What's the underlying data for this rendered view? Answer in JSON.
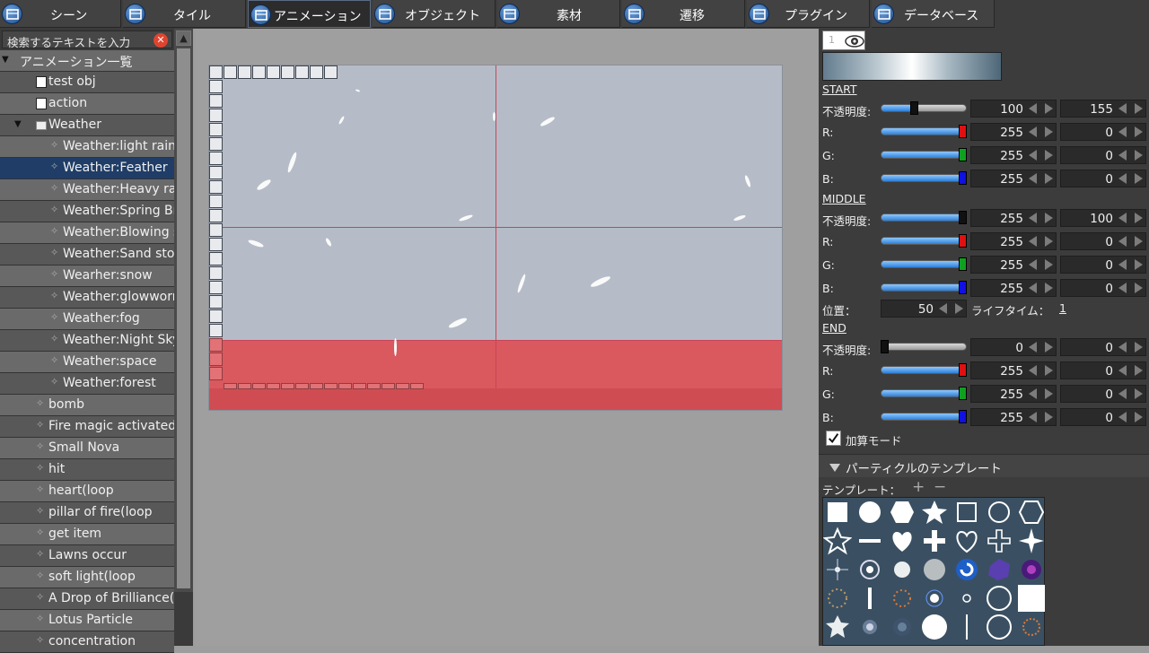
{
  "menu": {
    "tabs": [
      {
        "label": "シーン",
        "icon": "scene-icon"
      },
      {
        "label": "タイル",
        "icon": "tile-icon"
      },
      {
        "label": "アニメーション",
        "icon": "animation-icon",
        "active": true
      },
      {
        "label": "オブジェクト",
        "icon": "object-icon"
      },
      {
        "label": "素材",
        "icon": "material-icon"
      },
      {
        "label": "遷移",
        "icon": "transition-icon"
      },
      {
        "label": "プラグイン",
        "icon": "plugin-icon"
      },
      {
        "label": "データベース",
        "icon": "database-icon"
      }
    ]
  },
  "sidebar": {
    "search_placeholder": "検索するテキストを入力",
    "tree": [
      {
        "label": "アニメーション一覧",
        "kind": "root"
      },
      {
        "label": "test obj",
        "kind": "object"
      },
      {
        "label": "action",
        "kind": "object"
      },
      {
        "label": "Weather",
        "kind": "folder"
      },
      {
        "label": "Weather:light rain",
        "kind": "particle"
      },
      {
        "label": "Weather:Feather",
        "kind": "particle",
        "selected": true
      },
      {
        "label": "Weather:Heavy rain",
        "kind": "particle"
      },
      {
        "label": "Weather:Spring Breeze",
        "kind": "particle"
      },
      {
        "label": "Weather:Blowing snow",
        "kind": "particle"
      },
      {
        "label": "Weather:Sand storm",
        "kind": "particle"
      },
      {
        "label": "Wearher:snow",
        "kind": "particle"
      },
      {
        "label": "Weather:glowworm",
        "kind": "particle"
      },
      {
        "label": "Weather:fog",
        "kind": "particle"
      },
      {
        "label": "Weather:Night Sky",
        "kind": "particle"
      },
      {
        "label": "Weather:space",
        "kind": "particle"
      },
      {
        "label": "Weather:forest",
        "kind": "particle"
      },
      {
        "label": "bomb",
        "kind": "anim"
      },
      {
        "label": "Fire magic activated",
        "kind": "anim"
      },
      {
        "label": "Small Nova",
        "kind": "anim"
      },
      {
        "label": "hit",
        "kind": "anim"
      },
      {
        "label": "heart(loop",
        "kind": "anim"
      },
      {
        "label": "pillar of fire(loop",
        "kind": "anim"
      },
      {
        "label": "get item",
        "kind": "anim"
      },
      {
        "label": "Lawns occur",
        "kind": "anim"
      },
      {
        "label": "soft light(loop",
        "kind": "anim"
      },
      {
        "label": "A Drop of Brilliance(loop",
        "kind": "anim"
      },
      {
        "label": "Lotus Particle",
        "kind": "anim"
      },
      {
        "label": "concentration",
        "kind": "anim"
      }
    ]
  },
  "inspector": {
    "layer_number": "1",
    "start": {
      "title": "START",
      "rows": [
        {
          "label": "不透明度:",
          "value": "100",
          "value2": "155",
          "slider": 0.39,
          "color": "#2d7fd8"
        },
        {
          "label": "R:",
          "value": "255",
          "value2": "0",
          "slider": 1.0,
          "color": "#e01010"
        },
        {
          "label": "G:",
          "value": "255",
          "value2": "0",
          "slider": 1.0,
          "color": "#10a020"
        },
        {
          "label": "B:",
          "value": "255",
          "value2": "0",
          "slider": 1.0,
          "color": "#1010e0"
        }
      ]
    },
    "middle": {
      "title": "MIDDLE",
      "rows": [
        {
          "label": "不透明度:",
          "value": "255",
          "value2": "100",
          "slider": 1.0,
          "color": "#111111"
        },
        {
          "label": "R:",
          "value": "255",
          "value2": "0",
          "slider": 1.0,
          "color": "#e01010"
        },
        {
          "label": "G:",
          "value": "255",
          "value2": "0",
          "slider": 1.0,
          "color": "#10a020"
        },
        {
          "label": "B:",
          "value": "255",
          "value2": "0",
          "slider": 1.0,
          "color": "#1010e0"
        }
      ]
    },
    "position_label": "位置：",
    "position_value": "50",
    "lifetime_label": "ライフタイム：",
    "lifetime_value": "1",
    "end": {
      "title": "END",
      "rows": [
        {
          "label": "不透明度:",
          "value": "0",
          "value2": "0",
          "slider": 0.0,
          "color": "#111111"
        },
        {
          "label": "R:",
          "value": "255",
          "value2": "0",
          "slider": 1.0,
          "color": "#e01010"
        },
        {
          "label": "G:",
          "value": "255",
          "value2": "0",
          "slider": 1.0,
          "color": "#10a020"
        },
        {
          "label": "B:",
          "value": "255",
          "value2": "0",
          "slider": 1.0,
          "color": "#1010e0"
        }
      ]
    },
    "additive_label": "加算モード",
    "additive_checked": true,
    "template_header": "パーティクルのテンプレート",
    "template_label": "テンプレート：",
    "add_symbol": "+",
    "remove_symbol": "−"
  },
  "colors": {
    "accent": "#1f3d66",
    "stage_bg": "#b5bcc7",
    "stage_red": "#d9595e",
    "grid_line": "#c8455a"
  }
}
